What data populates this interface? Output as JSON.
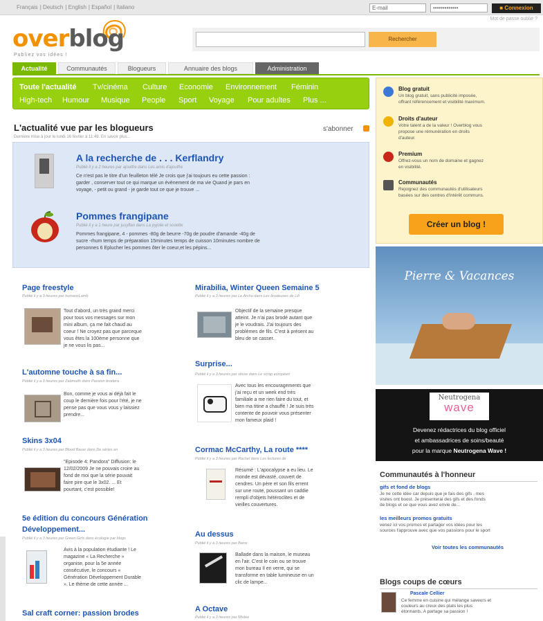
{
  "topbar": {
    "languages": [
      "Français",
      "Deutsch",
      "English",
      "Español",
      "Italiano"
    ],
    "email_placeholder": "E-mail",
    "password_value": "•••••••••••••",
    "login_label": "Connexion",
    "forgot": "Mot de passe oublié ?"
  },
  "logo": {
    "word_orange": "over",
    "word_gray": "blog",
    "tagline": "Publiez vos idées !"
  },
  "search": {
    "button": "Rechercher"
  },
  "nav": {
    "tabs": [
      "Actualité",
      "Communautés",
      "Blogueurs",
      "Annuaire des blogs",
      "Administration"
    ]
  },
  "categories": {
    "row1": [
      "Toute l'actualité",
      "Tv/cinéma",
      "Culture",
      "Economie",
      "Environnement",
      "Féminin"
    ],
    "row2": [
      "High-tech",
      "Humour",
      "Musique",
      "People",
      "Sport",
      "Voyage",
      "Pour adultes",
      "Plus ..."
    ]
  },
  "section": {
    "title": "L'actualité vue par les blogueurs",
    "subtitle": "Dernière mise à jour le lundi 16 février à 11:49. En savoir plus...",
    "subscribe": "s'abonner"
  },
  "featured": [
    {
      "title": "A la recherche de . . . Kerflandry",
      "meta": "Publié il y a 2 heures par ajoutfre dans Les amis d'ajoutfre",
      "text": [
        "Ce n'est pas le titre d'un feuilleton télé Je crois que j'ai toujours eu cette passion :",
        "garder , conserver tout ce qui marque un évènement de ma vie Quand je pars en",
        "voyage, - petit ou grand - je garde tout ce que je trouve ..."
      ]
    },
    {
      "title": "Pommes frangipane",
      "meta": "Publié il y a 1 heure par jusyflan dans La pyjolie et scoette",
      "text": [
        "Pommes frangipane, 4 - pommes -80g de beurre -70g de poudre d'amande -40g de",
        "sucre -rhum temps de préparation 15minutes temps de cuisson 10minutes nombre de",
        "personnes 6 Eplucher les pommes ôter le coeur,et les pépins..."
      ]
    }
  ],
  "posts_left": [
    {
      "title": "Page freestyle",
      "meta": "Publié il y a 3 heures par humansLamb",
      "text": [
        "Tout d'abord, un très grand merci",
        "pour tous vos messages sur mon",
        "mini album, ça me fait chaud au",
        "coeur ! Ne croyez pas que parceque",
        "vous êtes la 100ème personne que",
        "je ne vous lis pas..."
      ]
    },
    {
      "title": "L'automne touche à sa fin...",
      "meta": "Publié il y a 3 heures par Zabmuith dans Passion brodera",
      "text": [
        "Bon, comme je vous ai déjà fait le",
        "coup le dernière fois pour l'été, je ne",
        "pense pas que vous vous y laissiez",
        "prendre..."
      ]
    },
    {
      "title": "Skins 3x04",
      "meta": "Publié il y a 3 heures par Blood Bauer dans De séries en",
      "text": [
        "\"Episode 4: Pandora\" Diffusion: le",
        "12/02/2009 Je ne pouvais croire au",
        "fond de moi que la série pouvait",
        "faire pire que le 3x02. ... Et",
        "pourtant, c'est possible!"
      ]
    },
    {
      "title": "5e édition du concours Génération Développement...",
      "meta": "Publié il y a 3 heures par Green Girls dans écologie par blogs",
      "text": [
        "Avis à la population étudiante ! Le",
        "magazine « La Recherche »",
        "organise, pour la 5e année",
        "consécutive, le concours «",
        "Génération Développement Durable",
        "». Le thème de cette année ..."
      ]
    },
    {
      "title": "Sal craft corner: passion brodes",
      "meta": "",
      "text": []
    }
  ],
  "posts_right": [
    {
      "title": "Mirabilia, Winter Queen Semaine 5",
      "meta": "Publié il y a 3 heures par Le Archu dans Les brodeuses de Lili",
      "text": [
        "Objectif de la semaine presque",
        "atteint. Je n'ai pas brodé autant que",
        "je le voudrais. J'ai toujours des",
        "problèmes de fils. C'est à présent au",
        "bleu de se casser."
      ]
    },
    {
      "title": "Surprise...",
      "meta": "Publié il y a 3 heures par stisse dans Le scrap européen",
      "text": [
        "Avec tous les encouragements que",
        "j'ai reçu et un week end très",
        "familiale a me rien faire du tout, et",
        "bien ma titine a chauffé ! Je suis très",
        "contente de pouvoir vous présenter",
        "mon fameux plaid !"
      ]
    },
    {
      "title": "Cormac McCarthy, La route ****",
      "meta": "Publié il y a 3 heures par Rachel dans Les lectures de",
      "text": [
        "Résumé : L'apocalypse a eu lieu. Le",
        "monde est dévasté, couvert de",
        "cendres. Un père et son fils errent",
        "sur une route, poussant un caddie",
        "rempli d'objets hétéroclites et de",
        "vieilles couvertures."
      ]
    },
    {
      "title": "Au dessus",
      "meta": "Publié il y a 3 heures par Barre",
      "text": [
        "Ballade dans la maison, le museau",
        "en l'air. C'est le coin ou se trouve",
        "mon bureau Il en verre, qui se",
        "transforme en table lumineuse en un",
        "clic de lampe..."
      ]
    },
    {
      "title": "A Octave",
      "meta": "Publié il y a 3 heures par Mistee",
      "text": []
    }
  ],
  "sidebar": {
    "items": [
      {
        "title": "Blog gratuit",
        "text": [
          "Un blog gratuit, sans publicité imposée,",
          "offrant référencement et visibilité maximum."
        ]
      },
      {
        "title": "Droits d'auteur",
        "text": [
          "Votre talent a de la valeur ! Overblog vous",
          "propose une rémunération en droits",
          "d'auteur."
        ]
      },
      {
        "title": "Premium",
        "text": [
          "Offrez-vous un nom de domaine et gagnez",
          "en visibilité."
        ]
      },
      {
        "title": "Communautés",
        "text": [
          "Rejoignez des communautés d'utilisateurs",
          "basées sur des centres d'intérêt communs."
        ]
      }
    ],
    "create_button": "Créer un blog !"
  },
  "ad1": {
    "brand": "Pierre & Vacances"
  },
  "ad2": {
    "logo_top": "Neutrogena",
    "logo_bottom": "wave",
    "line1": "Devenez rédactrices du blog officiel",
    "line2": "et ambassadrices de soins/beauté",
    "line3_plain": "pour la marque ",
    "line3_bold": "Neutrogena Wave !"
  },
  "communities": {
    "title": "Communautés à l'honneur",
    "items": [
      {
        "title": "gifs et fond de blogs",
        "text": [
          "Je ne cette idée car depuis que je fais des gifs , mes",
          "visites ont boost. Je présenterai des gifs et des fonds",
          "de blogs et ce que vous avez envie de..."
        ]
      },
      {
        "title": "les meilleurs promos gratuits",
        "text": [
          "venez ici vos promos et partager vos idées pour les",
          "sources l'approuve avec que vos passions pour le sport"
        ]
      }
    ],
    "see_all": "Voir toutes les communautés"
  },
  "favorites": {
    "title": "Blogs coups de cœurs",
    "items": [
      {
        "name": "Pascale Cellier",
        "text": [
          "Ce femme en cuisine qui mélange saveurs et",
          "couleurs au creux des plats les plus",
          "étonnants. A partage sa passion !"
        ]
      }
    ]
  }
}
